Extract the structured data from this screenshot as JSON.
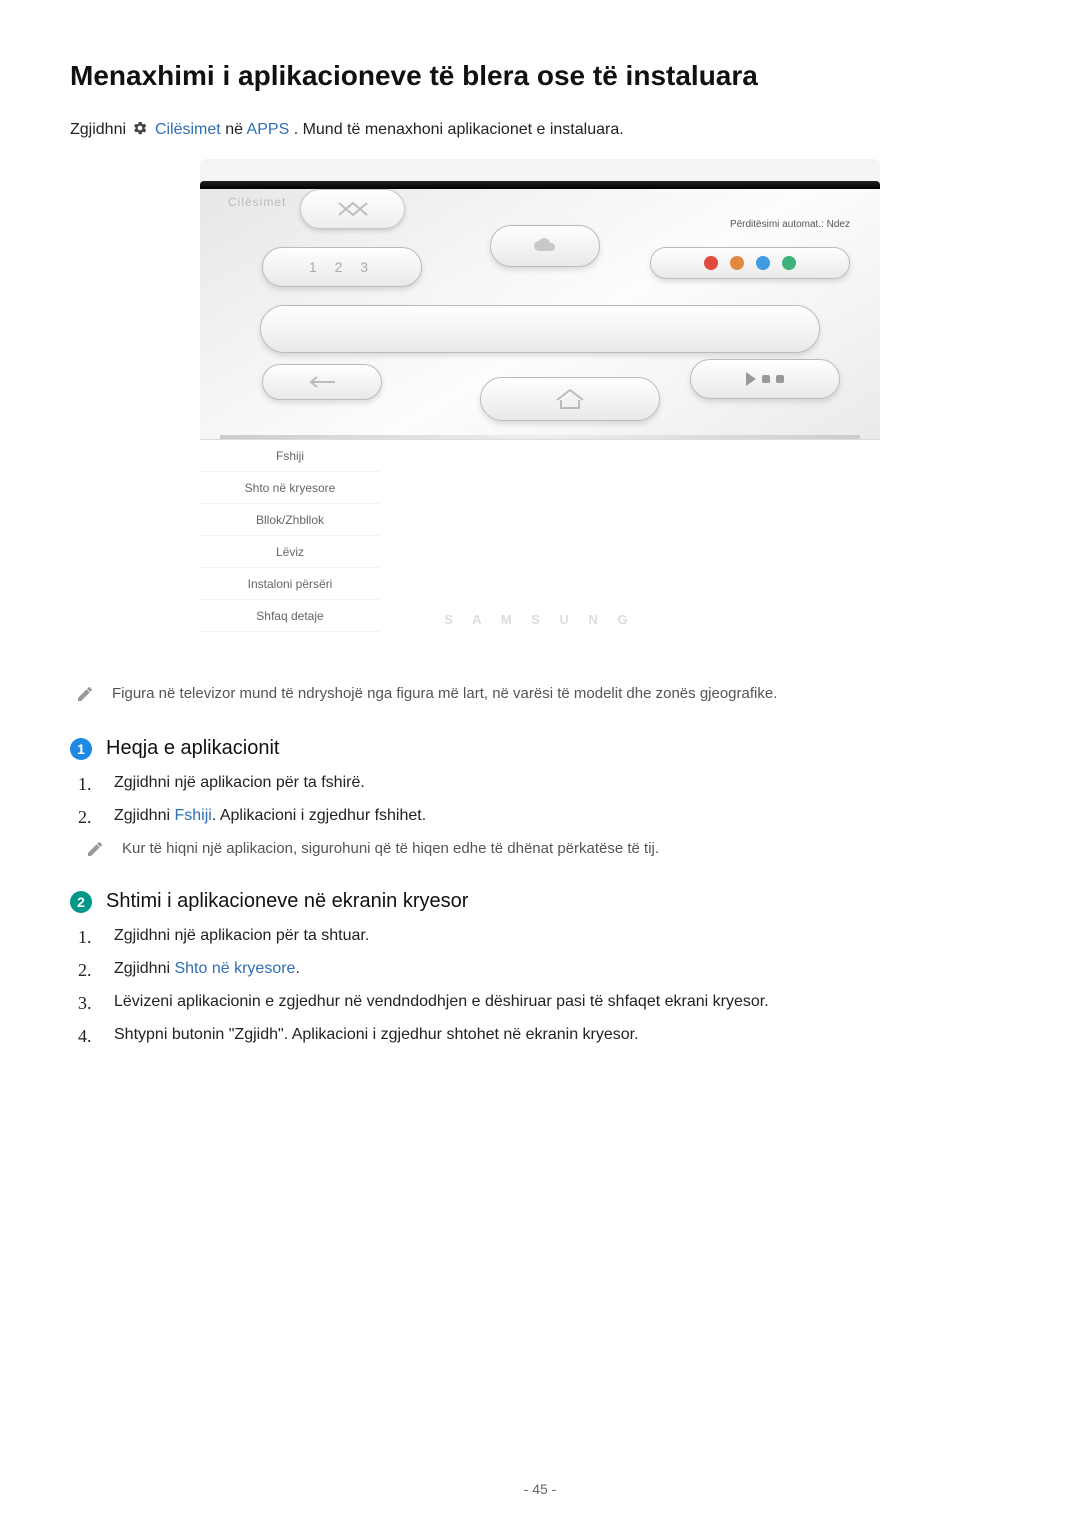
{
  "title": "Menaxhimi i aplikacioneve të blera ose të instaluara",
  "intro": {
    "prefix": "Zgjidhni ",
    "gear_icon_name": "gear-icon",
    "cilesimet": "Cilësimet",
    "mid": " në ",
    "apps": "APPS",
    "suffix": ". Mund të menaxhoni aplikacionet e instaluara."
  },
  "screenshot": {
    "top_label": "Cilësimet",
    "auto_update": "Përditësimi automat.: Ndez",
    "num_tile": "1 2 3",
    "context_menu": [
      "Fshiji",
      "Shto në kryesore",
      "Bllok/Zhbllok",
      "Lëviz",
      "Instaloni përsëri",
      "Shfaq detaje"
    ],
    "brand": "S A M S U N G"
  },
  "note1": "Figura në televizor mund të ndryshojë nga figura më lart, në varësi të modelit dhe zonës gjeografike.",
  "section1": {
    "num": "1",
    "title": "Heqja e aplikacionit",
    "steps": [
      {
        "n": "1.",
        "text_prefix": "Zgjidhni një aplikacion për ta fshirë.",
        "link": "",
        "text_suffix": ""
      },
      {
        "n": "2.",
        "text_prefix": "Zgjidhni ",
        "link": "Fshiji",
        "text_suffix": ". Aplikacioni i zgjedhur fshihet."
      }
    ],
    "note": "Kur të hiqni një aplikacion, sigurohuni që të hiqen edhe të dhënat përkatëse të tij."
  },
  "section2": {
    "num": "2",
    "title": "Shtimi i aplikacioneve në ekranin kryesor",
    "steps": [
      {
        "n": "1.",
        "text_prefix": "Zgjidhni një aplikacion për ta shtuar.",
        "link": "",
        "text_suffix": ""
      },
      {
        "n": "2.",
        "text_prefix": "Zgjidhni ",
        "link": "Shto në kryesore",
        "text_suffix": "."
      },
      {
        "n": "3.",
        "text_prefix": "Lëvizeni aplikacionin e zgjedhur në vendndodhjen e dëshiruar pasi të shfaqet ekrani kryesor.",
        "link": "",
        "text_suffix": ""
      },
      {
        "n": "4.",
        "text_prefix": "Shtypni butonin \"Zgjidh\". Aplikacioni i zgjedhur shtohet në ekranin kryesor.",
        "link": "",
        "text_suffix": ""
      }
    ]
  },
  "page_number": "- 45 -"
}
